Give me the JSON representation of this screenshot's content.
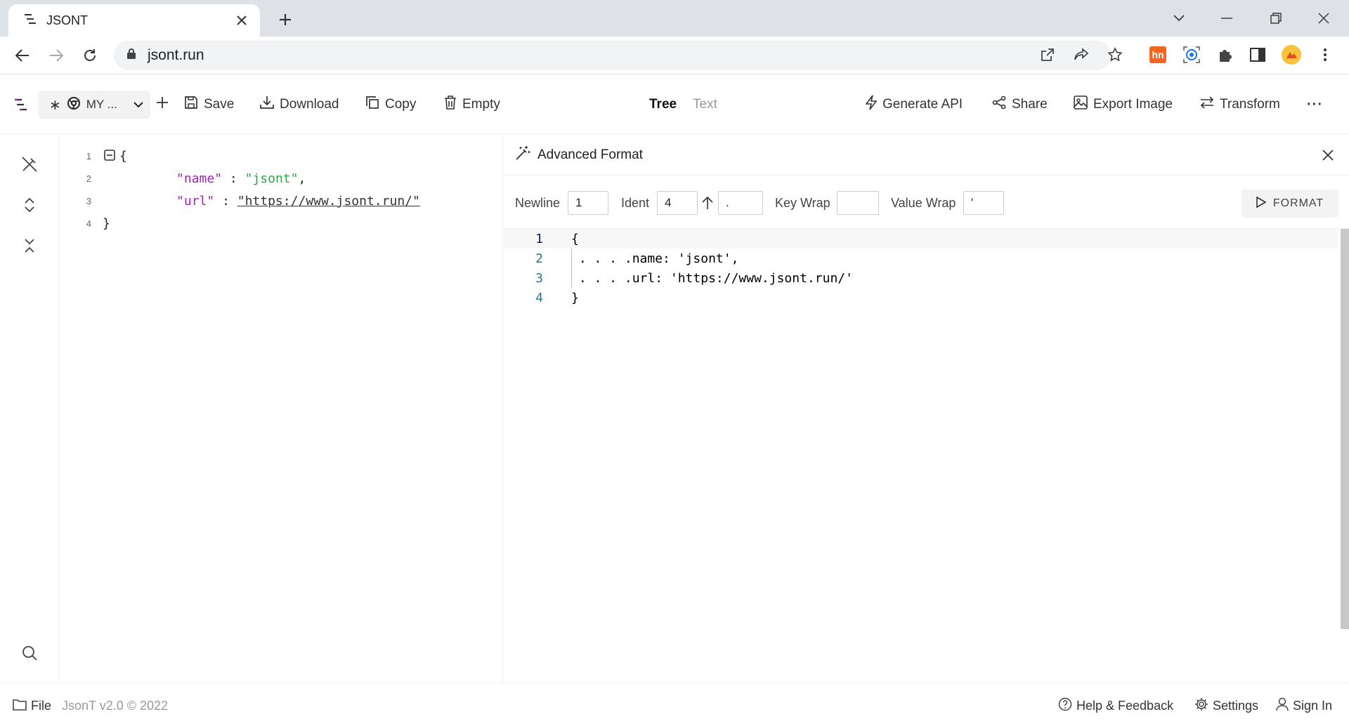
{
  "browser": {
    "tab_title": "JSONT",
    "url": "jsont.run"
  },
  "header": {
    "doc_label": "MY ...",
    "save": "Save",
    "download": "Download",
    "copy": "Copy",
    "empty": "Empty",
    "view_tree": "Tree",
    "view_text": "Text",
    "generate_api": "Generate API",
    "share": "Share",
    "export_image": "Export Image",
    "transform": "Transform",
    "more": "···"
  },
  "tree": {
    "line_numbers": [
      "1",
      "2",
      "3",
      "4"
    ],
    "open_brace": "{",
    "close_brace": "}",
    "name_key": "\"name\"",
    "name_value": "\"jsont\"",
    "url_key": "\"url\"",
    "url_value": "\"https://www.jsont.run/\"",
    "colon": ":",
    "comma": ","
  },
  "panel": {
    "title": "Advanced Format",
    "newline_label": "Newline",
    "newline_value": "1",
    "ident_label": "Ident",
    "ident_value": "4",
    "ident_char": ".",
    "key_wrap_label": "Key Wrap",
    "key_wrap_value": "",
    "value_wrap_label": "Value Wrap",
    "value_wrap_value": "'",
    "format_button": "FORMAT",
    "code_lines": [
      {
        "num": "1",
        "text": "{"
      },
      {
        "num": "2",
        "text": " . . . .name: 'jsont',"
      },
      {
        "num": "3",
        "text": " . . . .url: 'https://www.jsont.run/'"
      },
      {
        "num": "4",
        "text": "}"
      }
    ]
  },
  "footer": {
    "file": "File",
    "version": "JsonT v2.0 © 2022",
    "help": "Help & Feedback",
    "settings": "Settings",
    "sign_in": "Sign In"
  }
}
